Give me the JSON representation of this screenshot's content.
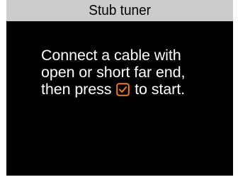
{
  "header": {
    "title": "Stub tuner"
  },
  "message": {
    "line1": "Connect a cable with",
    "line2": "open or short far end,",
    "line3_before": "then press",
    "line3_after": "to start."
  },
  "icons": {
    "start": "checkbox-check-icon"
  },
  "colors": {
    "background": "#000000",
    "title_bar": "#cccccc",
    "text": "#ffffff",
    "accent": "#f07a1a"
  }
}
